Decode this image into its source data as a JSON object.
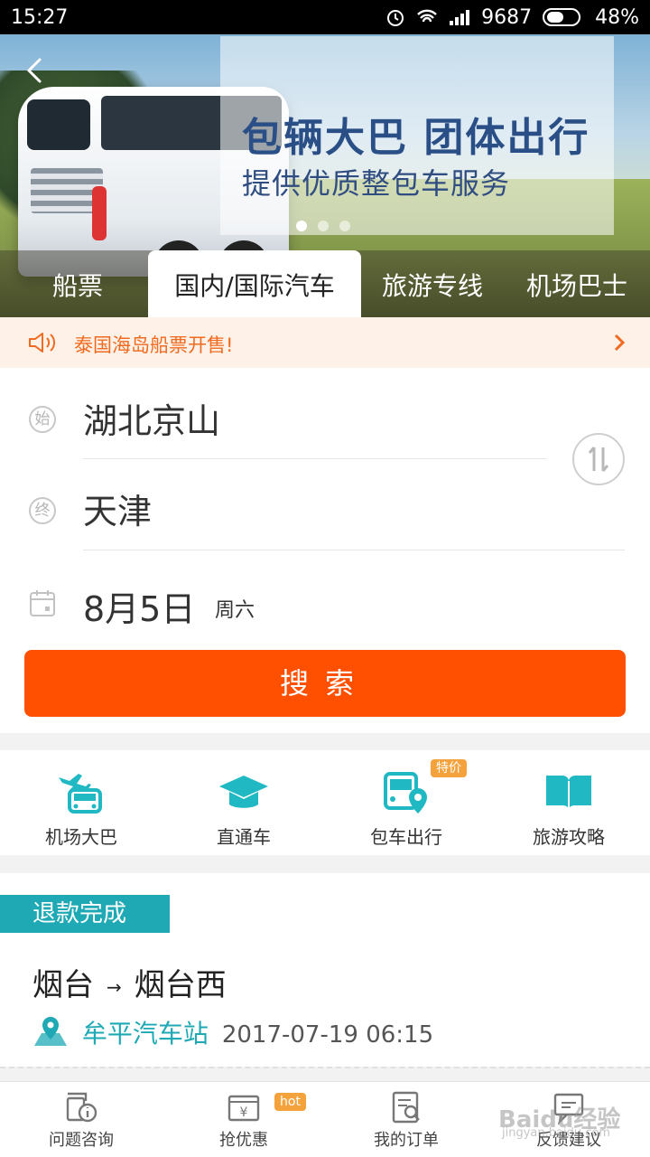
{
  "status_bar": {
    "time": "15:27",
    "signal_text": "9687",
    "battery": "48%"
  },
  "banner": {
    "headline": "包辆大巴 团体出行",
    "subline": "提供优质整包车服务"
  },
  "tabs": [
    {
      "label": "船票"
    },
    {
      "label": "国内/国际汽车"
    },
    {
      "label": "旅游专线"
    },
    {
      "label": "机场巴士"
    }
  ],
  "notice": {
    "text": "泰国海岛船票开售!"
  },
  "form": {
    "start_marker": "始",
    "end_marker": "终",
    "start_city": "湖北京山",
    "end_city": "天津",
    "date": "8月5日",
    "weekday": "周六",
    "search_label": "搜索"
  },
  "quick_links": [
    {
      "label": "机场大巴",
      "icon": "airport-bus-icon"
    },
    {
      "label": "直通车",
      "icon": "graduation-cap-icon"
    },
    {
      "label": "包车出行",
      "icon": "charter-bus-icon",
      "tag": "特价"
    },
    {
      "label": "旅游攻略",
      "icon": "open-book-icon"
    }
  ],
  "order": {
    "status": "退款完成",
    "from": "烟台",
    "arrow": "→",
    "to": "烟台西",
    "station": "牟平汽车站",
    "datetime": "2017-07-19 06:15"
  },
  "bottom_nav": [
    {
      "label": "问题咨询",
      "icon": "consult-icon"
    },
    {
      "label": "抢优惠",
      "icon": "coupon-icon",
      "tag": "hot"
    },
    {
      "label": "我的订单",
      "icon": "order-icon"
    },
    {
      "label": "反馈建议",
      "icon": "feedback-icon"
    }
  ],
  "watermark": {
    "text": "Baidu经验",
    "sub": "jingyan.baidu.com"
  },
  "colors": {
    "accent": "#fe5000",
    "teal": "#1fa9b5",
    "notice": "#f06a1f"
  }
}
